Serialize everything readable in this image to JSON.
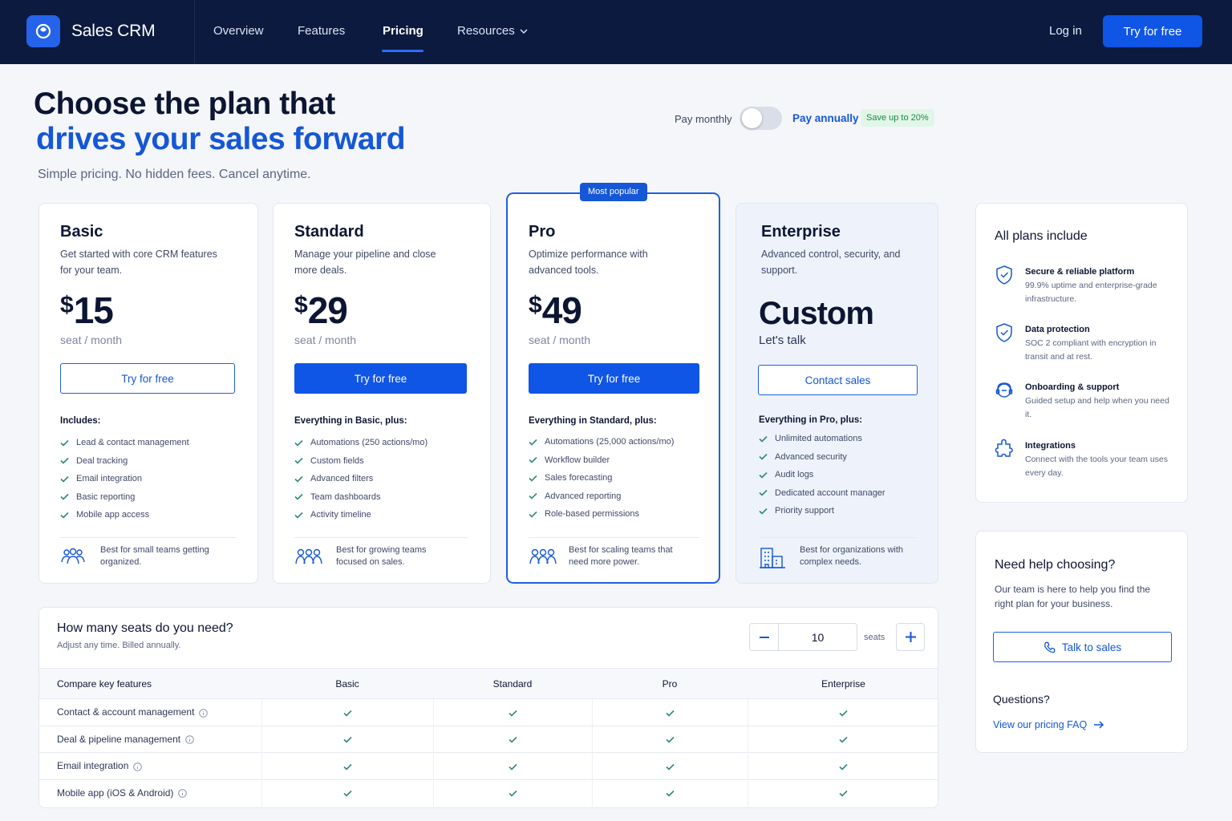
{
  "nav": {
    "brand": "Sales CRM",
    "links": [
      "Overview",
      "Features",
      "Pricing",
      "Resources"
    ],
    "login": "Log in",
    "cta": "Try for free"
  },
  "hero": {
    "title_line1": "Choose the plan that",
    "title_line2": "drives your sales forward",
    "subtitle": "Simple pricing. No hidden fees. Cancel anytime."
  },
  "billing": {
    "monthly": "Pay monthly",
    "annually": "Pay annually",
    "save_badge": "Save up to 20%",
    "annual_selected": false
  },
  "plans": [
    {
      "name": "Basic",
      "description": "Get started with core CRM features for your team.",
      "currency": "$",
      "price": "15",
      "period": "seat / month",
      "cta": "Try for free",
      "includes_title": "Includes:",
      "features": [
        "Lead & contact management",
        "Deal tracking",
        "Email integration",
        "Basic reporting",
        "Mobile app access"
      ],
      "footer": "Best for small teams getting organized."
    },
    {
      "name": "Standard",
      "description": "Manage your pipeline and close more deals.",
      "currency": "$",
      "price": "29",
      "period": "seat / month",
      "cta": "Try for free",
      "includes_title": "Everything in Basic, plus:",
      "features": [
        "Automations (250 actions/mo)",
        "Custom fields",
        "Advanced filters",
        "Team dashboards",
        "Activity timeline"
      ],
      "footer": "Best for growing teams focused on sales."
    },
    {
      "name": "Pro",
      "badge": "Most popular",
      "description": "Optimize performance with advanced tools.",
      "currency": "$",
      "price": "49",
      "period": "seat / month",
      "cta": "Try for free",
      "includes_title": "Everything in Standard, plus:",
      "features": [
        "Automations (25,000 actions/mo)",
        "Workflow builder",
        "Sales forecasting",
        "Advanced reporting",
        "Role-based permissions"
      ],
      "footer": "Best for scaling teams that need more power."
    },
    {
      "name": "Enterprise",
      "description": "Advanced control, security, and support.",
      "price": "Custom",
      "period": "Let's talk",
      "cta": "Contact sales",
      "includes_title": "Everything in Pro, plus:",
      "features": [
        "Unlimited automations",
        "Advanced security",
        "Audit logs",
        "Dedicated account manager",
        "Priority support"
      ],
      "footer": "Best for organizations with complex needs."
    }
  ],
  "all_plans": {
    "title": "All plans include",
    "items": [
      {
        "icon": "shield-check-icon",
        "title": "Secure & reliable platform",
        "desc": "99.9% uptime and enterprise-grade infrastructure."
      },
      {
        "icon": "shield-check-icon",
        "title": "Data protection",
        "desc": "SOC 2 compliant with encryption in transit and at rest."
      },
      {
        "icon": "support-icon",
        "title": "Onboarding & support",
        "desc": "Guided setup and help when you need it."
      },
      {
        "icon": "puzzle-icon",
        "title": "Integrations",
        "desc": "Connect with the tools your team uses every day."
      }
    ]
  },
  "help": {
    "title": "Need help choosing?",
    "desc": "Our team is here to help you find the right plan for your business.",
    "button": "Talk to sales",
    "questions": "Questions?",
    "faq_link": "View our pricing FAQ"
  },
  "seats": {
    "title": "How many seats do you need?",
    "subtitle": "Adjust any time. Billed annually.",
    "value": "10",
    "label": "seats"
  },
  "compare": {
    "header": [
      "Compare key features",
      "Basic",
      "Standard",
      "Pro",
      "Enterprise"
    ],
    "rows": [
      {
        "feature": "Contact & account management",
        "values": [
          true,
          true,
          true,
          true
        ]
      },
      {
        "feature": "Deal & pipeline management",
        "values": [
          true,
          true,
          true,
          true
        ]
      },
      {
        "feature": "Email integration",
        "values": [
          true,
          true,
          true,
          true
        ]
      },
      {
        "feature": "Mobile app (iOS & Android)",
        "values": [
          true,
          true,
          true,
          true
        ]
      }
    ]
  },
  "colors": {
    "nav_bg": "#0b1a3e",
    "primary": "#1557d6",
    "success": "#178a48",
    "check": "#2e8a7a"
  }
}
